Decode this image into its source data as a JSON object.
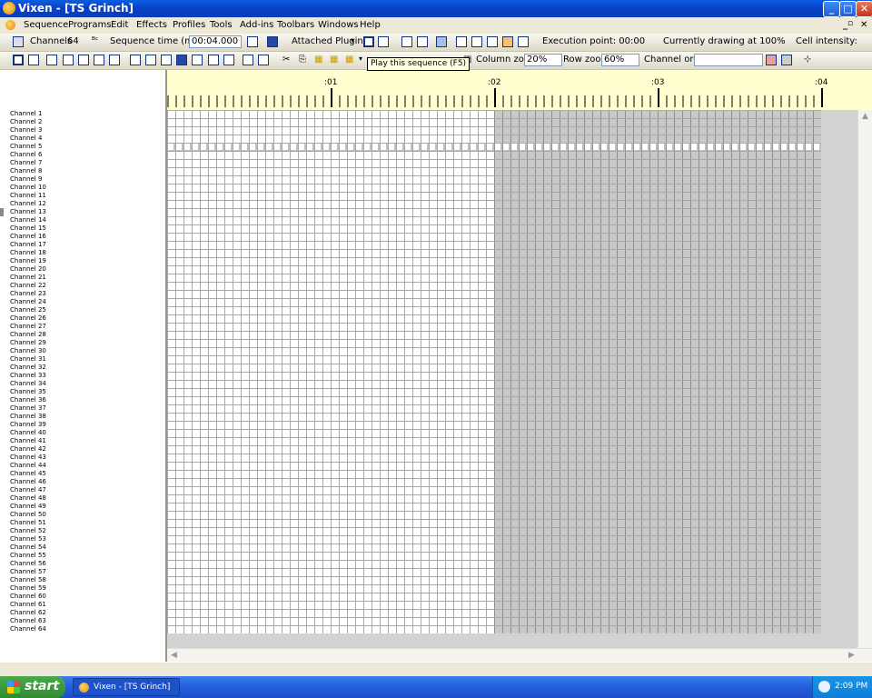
{
  "window": {
    "title": "Vixen - [TS Grinch]"
  },
  "menu": [
    "Sequence",
    "Programs",
    "Edit",
    "Effects",
    "Profiles",
    "Tools",
    "Add-ins",
    "Toolbars",
    "Windows",
    "Help"
  ],
  "toolbar1": {
    "channels_label": "Channels",
    "channels_value": "64",
    "sequence_time_label": "Sequence time (mm:ss)",
    "sequence_time_value": "00:04.000",
    "attached_plugins": "Attached Plugins",
    "execution_point": "Execution point:  00:00",
    "drawing_at": "Currently drawing at  100%",
    "cell_intensity": "Cell intensity:"
  },
  "toolbar2": {
    "column_zoom_label": "Column zoom",
    "column_zoom_value": "20%",
    "row_zoom_label": "Row zoom",
    "row_zoom_value": "60%",
    "channel_order_label": "Channel order",
    "channel_order_value": ""
  },
  "tooltip": "Play this sequence (F5)",
  "ruler": {
    "labels": [
      ":01",
      ":02",
      ":03",
      ":04"
    ],
    "label_seconds": [
      1,
      2,
      3,
      4
    ],
    "total_seconds": 4,
    "ticks_per_second": 20
  },
  "grid": {
    "columns": 80,
    "rows": 64,
    "played_columns": 40,
    "highlight_row": 5
  },
  "channels": [
    "Channel 1",
    "Channel 2",
    "Channel 3",
    "Channel 4",
    "Channel 5",
    "Channel 6",
    "Channel 7",
    "Channel 8",
    "Channel 9",
    "Channel 10",
    "Channel 11",
    "Channel 12",
    "Channel 13",
    "Channel 14",
    "Channel 15",
    "Channel 16",
    "Channel 17",
    "Channel 18",
    "Channel 19",
    "Channel 20",
    "Channel 21",
    "Channel 22",
    "Channel 23",
    "Channel 24",
    "Channel 25",
    "Channel 26",
    "Channel 27",
    "Channel 28",
    "Channel 29",
    "Channel 30",
    "Channel 31",
    "Channel 32",
    "Channel 33",
    "Channel 34",
    "Channel 35",
    "Channel 36",
    "Channel 37",
    "Channel 38",
    "Channel 39",
    "Channel 40",
    "Channel 41",
    "Channel 42",
    "Channel 43",
    "Channel 44",
    "Channel 45",
    "Channel 46",
    "Channel 47",
    "Channel 48",
    "Channel 49",
    "Channel 50",
    "Channel 51",
    "Channel 52",
    "Channel 53",
    "Channel 54",
    "Channel 55",
    "Channel 56",
    "Channel 57",
    "Channel 58",
    "Channel 59",
    "Channel 60",
    "Channel 61",
    "Channel 62",
    "Channel 63",
    "Channel 64"
  ],
  "taskbar": {
    "start": "start",
    "task": "Vixen - [TS Grinch]",
    "clock": "2:09 PM"
  }
}
